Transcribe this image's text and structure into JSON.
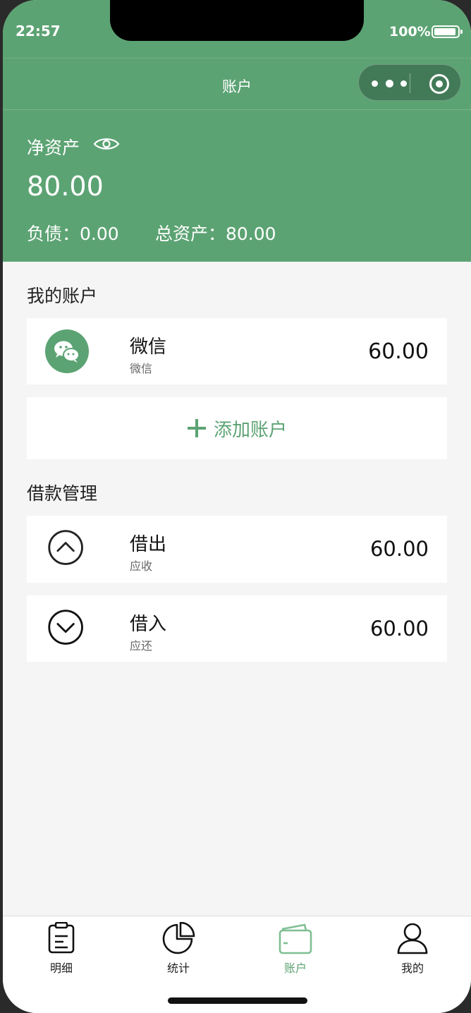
{
  "status_bar": {
    "time": "22:57",
    "battery": "100%"
  },
  "nav": {
    "title": "账户"
  },
  "summary": {
    "net_assets_label": "净资产",
    "net_assets_value": "80.00",
    "liabilities": "负债：0.00",
    "total_assets": "总资产：80.00"
  },
  "my_accounts": {
    "title": "我的账户",
    "items": [
      {
        "name": "微信",
        "type": "微信",
        "amount": "60.00",
        "icon": "wechat-icon"
      }
    ],
    "add_label": "添加账户"
  },
  "loans": {
    "title": "借款管理",
    "items": [
      {
        "name": "借出",
        "sub": "应收",
        "amount": "60.00",
        "icon": "chevron-up-circle-icon"
      },
      {
        "name": "借入",
        "sub": "应还",
        "amount": "60.00",
        "icon": "chevron-down-circle-icon"
      }
    ]
  },
  "tabs": [
    {
      "label": "明细",
      "icon": "list-icon",
      "active": false
    },
    {
      "label": "统计",
      "icon": "pie-chart-icon",
      "active": false
    },
    {
      "label": "账户",
      "icon": "wallet-icon",
      "active": true
    },
    {
      "label": "我的",
      "icon": "user-icon",
      "active": false
    }
  ],
  "colors": {
    "primary": "#5ca373",
    "capsule": "#427a57",
    "background": "#f5f5f5"
  }
}
